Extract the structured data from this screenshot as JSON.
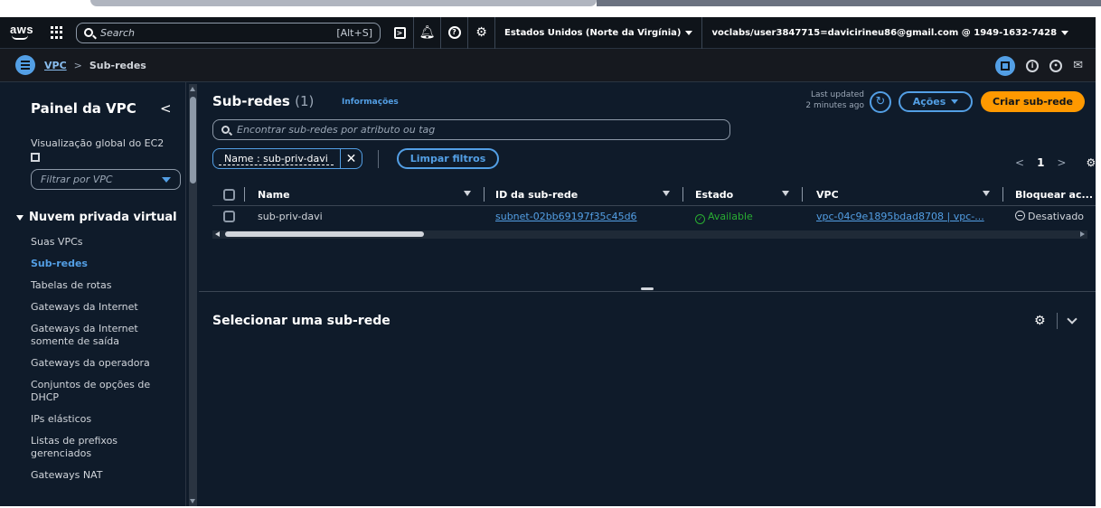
{
  "topnav": {
    "logo": "aws",
    "search_placeholder": "Search",
    "search_shortcut": "[Alt+S]",
    "icons": [
      "services-grid-icon",
      "cloudshell-icon",
      "bell-icon",
      "help-icon",
      "gear-icon"
    ],
    "region": "Estados Unidos (Norte da Virgínia)",
    "account": "voclabs/user3847715=davicirineu86@gmail.com @ 1949-1632-7428"
  },
  "breadcrumb": {
    "root": "VPC",
    "current": "Sub-redes"
  },
  "sidebar": {
    "title": "Painel da VPC",
    "global_view": "Visualização global do EC2",
    "filter_placeholder": "Filtrar por VPC",
    "section": "Nuvem privada virtual",
    "items": [
      {
        "label": "Suas VPCs",
        "active": false
      },
      {
        "label": "Sub-redes",
        "active": true
      },
      {
        "label": "Tabelas de rotas",
        "active": false
      },
      {
        "label": "Gateways da Internet",
        "active": false
      },
      {
        "label": "Gateways da Internet somente de saída",
        "active": false
      },
      {
        "label": "Gateways da operadora",
        "active": false
      },
      {
        "label": "Conjuntos de opções de DHCP",
        "active": false
      },
      {
        "label": "IPs elásticos",
        "active": false
      },
      {
        "label": "Listas de prefixos gerenciados",
        "active": false
      },
      {
        "label": "Gateways NAT",
        "active": false
      }
    ]
  },
  "table": {
    "title": "Sub-redes",
    "count": "(1)",
    "info_link": "Informações",
    "last_updated_label": "Last updated",
    "last_updated_value": "2 minutes ago",
    "actions_label": "Ações",
    "create_label": "Criar sub-rede",
    "search_placeholder": "Encontrar sub-redes por atributo ou tag",
    "filter_token": "Name : sub-priv-davi",
    "clear_filters_label": "Limpar filtros",
    "page": "1",
    "columns": [
      "Name",
      "ID da sub-rede",
      "Estado",
      "VPC",
      "Bloquear ac..."
    ],
    "rows": [
      {
        "name": "sub-priv-davi",
        "subnet_id": "subnet-02bb69197f35c45d6",
        "state": "Available",
        "vpc": "vpc-04c9e1895bdad8708 | vpc-...",
        "block": "Desativado"
      }
    ]
  },
  "detail": {
    "title": "Selecionar uma sub-rede"
  },
  "colors": {
    "accent": "#539fe5",
    "primary_button": "#ff9900",
    "available": "#29ad32",
    "background": "#0f1b2a",
    "topnav": "#0f141a"
  }
}
